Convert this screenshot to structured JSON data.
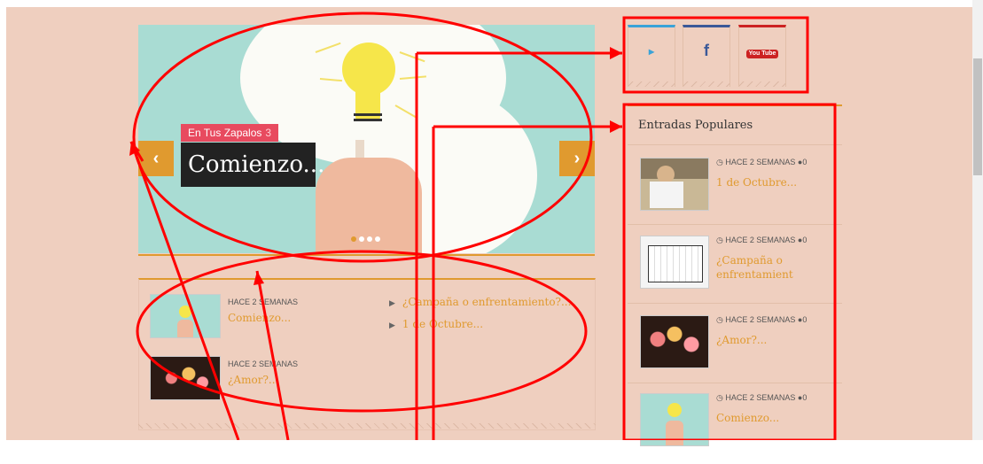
{
  "colors": {
    "background": "#efcfbf",
    "accent": "#e09a2f",
    "category": "#e84a5f",
    "annotation": "#ff0000"
  },
  "slider": {
    "category": "En Tus Zapalos",
    "category_count": "3",
    "title": "Comienzo...",
    "prev_icon": "‹",
    "next_icon": "›",
    "dots_count": 4
  },
  "recent": {
    "posts": [
      {
        "meta": "HACE 2 SEMANAS",
        "title": "Comienzo..."
      },
      {
        "meta": "HACE 2 SEMANAS",
        "title": "¿Amor?..."
      }
    ],
    "links": [
      "¿Campaña o enfrentamiento?...",
      "1 de Octubre..."
    ]
  },
  "social": [
    {
      "name": "twitter-icon",
      "glyph": "🐦"
    },
    {
      "name": "facebook-icon",
      "glyph": "f"
    },
    {
      "name": "youtube-icon",
      "glyph": "You Tube"
    }
  ],
  "popular": {
    "heading": "Entradas Populares",
    "items": [
      {
        "meta": "HACE 2 SEMANAS",
        "comments": "0",
        "title": "1 de Octubre..."
      },
      {
        "meta": "HACE 2 SEMANAS",
        "comments": "0",
        "title": "¿Campaña o enfrentamient"
      },
      {
        "meta": "HACE 2 SEMANAS",
        "comments": "0",
        "title": "¿Amor?..."
      },
      {
        "meta": "HACE 2 SEMANAS",
        "comments": "0",
        "title": "Comienzo..."
      }
    ]
  }
}
